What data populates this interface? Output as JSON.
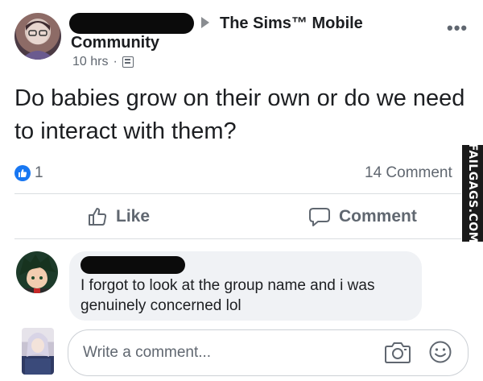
{
  "post": {
    "group": "The Sims™ Mobile",
    "group_suffix": "Community",
    "time": "10 hrs",
    "separator": "·",
    "text": "Do babies grow on their own or do we need to interact with them?",
    "reactions_count": "1",
    "comments_count": "14 Comment",
    "more_label": "•••"
  },
  "actions": {
    "like_label": "Like",
    "comment_label": "Comment"
  },
  "comment": {
    "text": "I forgot to look at the group name and i was genuinely concerned lol"
  },
  "composer": {
    "placeholder": "Write a comment..."
  },
  "watermark": {
    "text": "FAILGAGS.COM"
  },
  "colors": {
    "facebook_blue": "#1877f2",
    "text_primary": "#1c1e21",
    "text_secondary": "#606770",
    "bubble_bg": "#f0f2f5"
  }
}
